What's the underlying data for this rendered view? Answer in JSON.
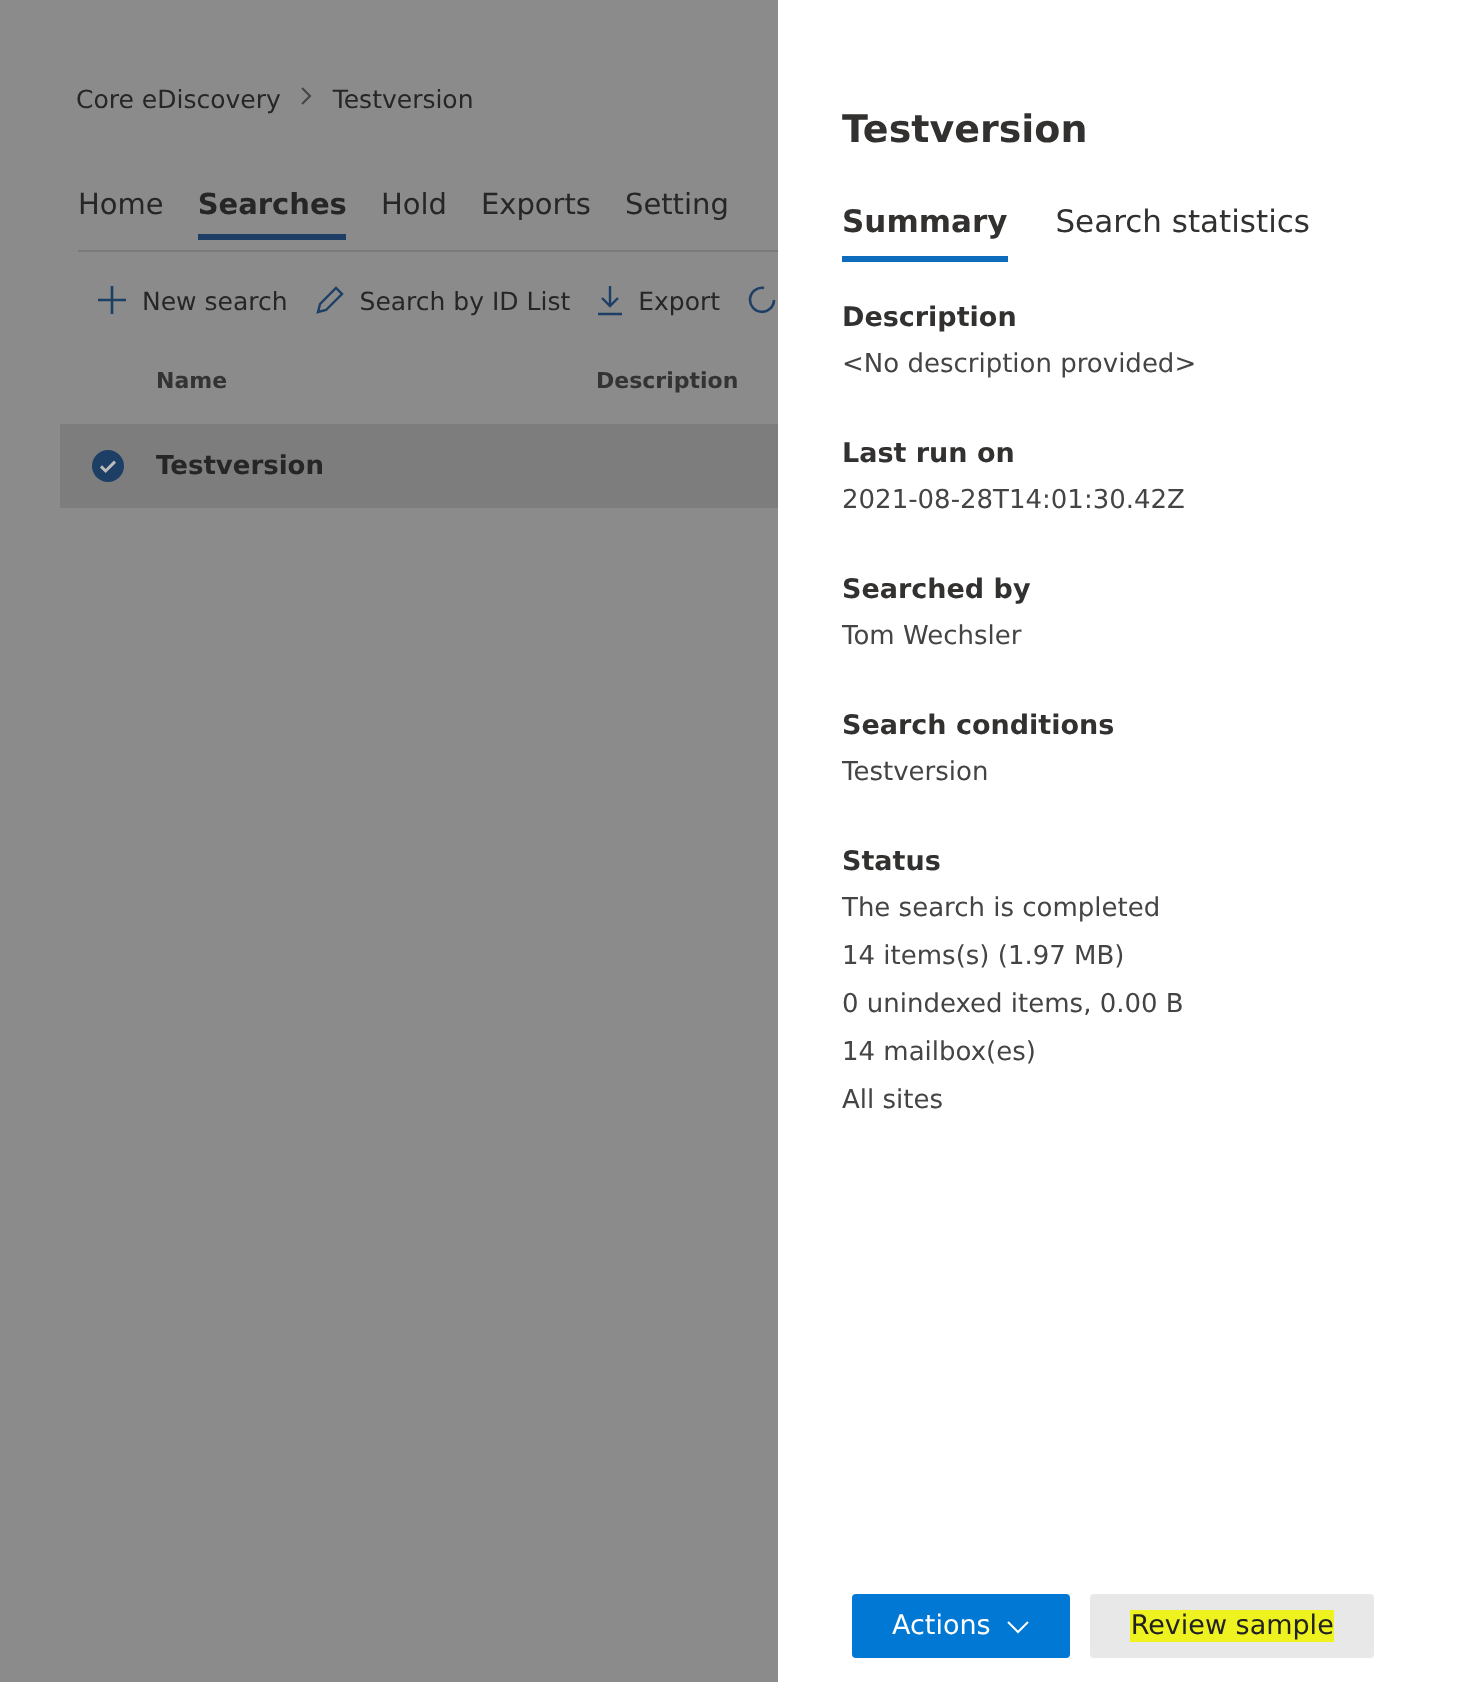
{
  "background": {
    "breadcrumb": [
      "Core eDiscovery",
      "Testversion"
    ],
    "tabs": [
      {
        "label": "Home",
        "selected": false
      },
      {
        "label": "Searches",
        "selected": true
      },
      {
        "label": "Hold",
        "selected": false
      },
      {
        "label": "Exports",
        "selected": false
      },
      {
        "label": "Setting",
        "selected": false
      }
    ],
    "commands": [
      {
        "kind": "add",
        "label": "New search"
      },
      {
        "kind": "edit",
        "label": "Search by ID List"
      },
      {
        "kind": "download",
        "label": "Export"
      },
      {
        "kind": "refresh"
      }
    ],
    "table": {
      "columns": [
        "Name",
        "Description"
      ],
      "rows": [
        {
          "name": "Testversion",
          "selected": true
        }
      ]
    }
  },
  "panel": {
    "title": "Testversion",
    "tabs": [
      {
        "label": "Summary",
        "selected": true
      },
      {
        "label": "Search statistics",
        "selected": false
      }
    ],
    "fields": [
      {
        "label": "Description",
        "values": [
          "<No description provided>"
        ]
      },
      {
        "label": "Last run on",
        "values": [
          "2021-08-28T14:01:30.42Z"
        ]
      },
      {
        "label": "Searched by",
        "values": [
          "Tom Wechsler"
        ]
      },
      {
        "label": "Search conditions",
        "values": [
          "Testversion"
        ]
      },
      {
        "label": "Status",
        "values": [
          "The search is completed",
          "14 items(s) (1.97 MB)",
          "0 unindexed items, 0.00 B",
          "14 mailbox(es)",
          "All sites"
        ]
      }
    ],
    "buttons": [
      {
        "kind": "primary-menu",
        "label": "Actions",
        "highlighted": false
      },
      {
        "kind": "secondary",
        "label": "Review sample",
        "highlighted": true
      }
    ]
  }
}
